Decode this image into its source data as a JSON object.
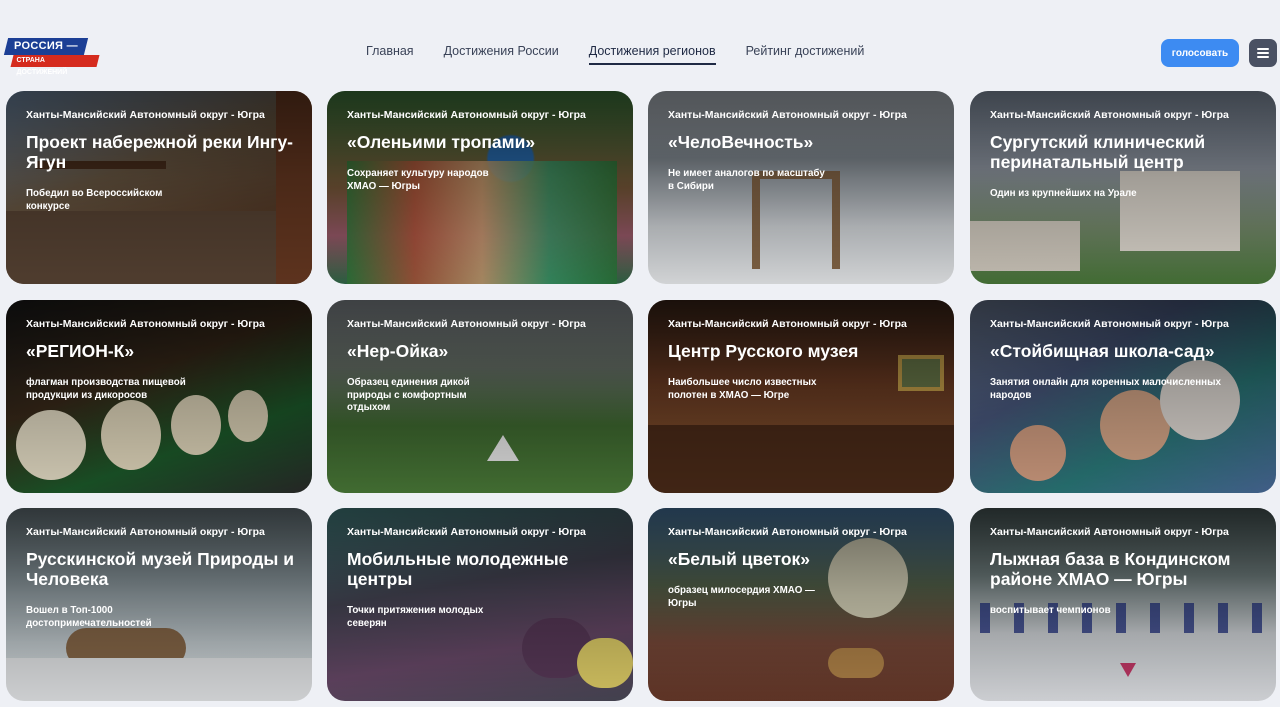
{
  "header": {
    "logo_top": "РОССИЯ —",
    "logo_bottom": "СТРАНА ДОСТИЖЕНИЙ",
    "nav": [
      {
        "label": "Главная",
        "active": false
      },
      {
        "label": "Достижения России",
        "active": false
      },
      {
        "label": "Достижения регионов",
        "active": true
      },
      {
        "label": "Рейтинг достижений",
        "active": false
      }
    ],
    "vote_label": "голосовать"
  },
  "cards": [
    {
      "region": "Ханты-Мансийский Автономный округ - Югра",
      "title": "Проект набережной реки Ингу-Ягун",
      "desc": "Победил во Всероссийском конкурсе"
    },
    {
      "region": "Ханты-Мансийский Автономный округ - Югра",
      "title": "«Оленьими тропами»",
      "desc": "Сохраняет культуру народов ХМАО — Югры"
    },
    {
      "region": "Ханты-Мансийский Автономный округ - Югра",
      "title": "«ЧелоВечность»",
      "desc": "Не имеет аналогов по масштабу в Сибири"
    },
    {
      "region": "Ханты-Мансийский Автономный округ - Югра",
      "title": "Сургутский клинический перинатальный центр",
      "desc": "Один из крупнейших на Урале"
    },
    {
      "region": "Ханты-Мансийский Автономный округ - Югра",
      "title": "«РЕГИОН-К»",
      "desc": "флагман производства пищевой продукции из дикоросов"
    },
    {
      "region": "Ханты-Мансийский Автономный округ - Югра",
      "title": "«Нер-Ойка»",
      "desc": "Образец единения дикой природы с комфортным отдыхом"
    },
    {
      "region": "Ханты-Мансийский Автономный округ - Югра",
      "title": "Центр Русского музея",
      "desc": "Наибольшее число известных полотен в ХМАО — Югре"
    },
    {
      "region": "Ханты-Мансийский Автономный округ - Югра",
      "title": "«Стойбищная школа-сад»",
      "desc": "Занятия онлайн для коренных малочисленных народов"
    },
    {
      "region": "Ханты-Мансийский Автономный округ - Югра",
      "title": "Русскинской музей Природы и Человека",
      "desc": "Вошел в Топ-1000 достопримечательностей"
    },
    {
      "region": "Ханты-Мансийский Автономный округ - Югра",
      "title": "Мобильные молодежные центры",
      "desc": "Точки притяжения молодых северян"
    },
    {
      "region": "Ханты-Мансийский Автономный округ - Югра",
      "title": "«Белый цветок»",
      "desc": "образец милосердия ХМАО — Югры"
    },
    {
      "region": "Ханты-Мансийский Автономный округ - Югра",
      "title": "Лыжная база в Кондинском районе ХМАО — Югры",
      "desc": "воспитывает чемпионов"
    }
  ]
}
